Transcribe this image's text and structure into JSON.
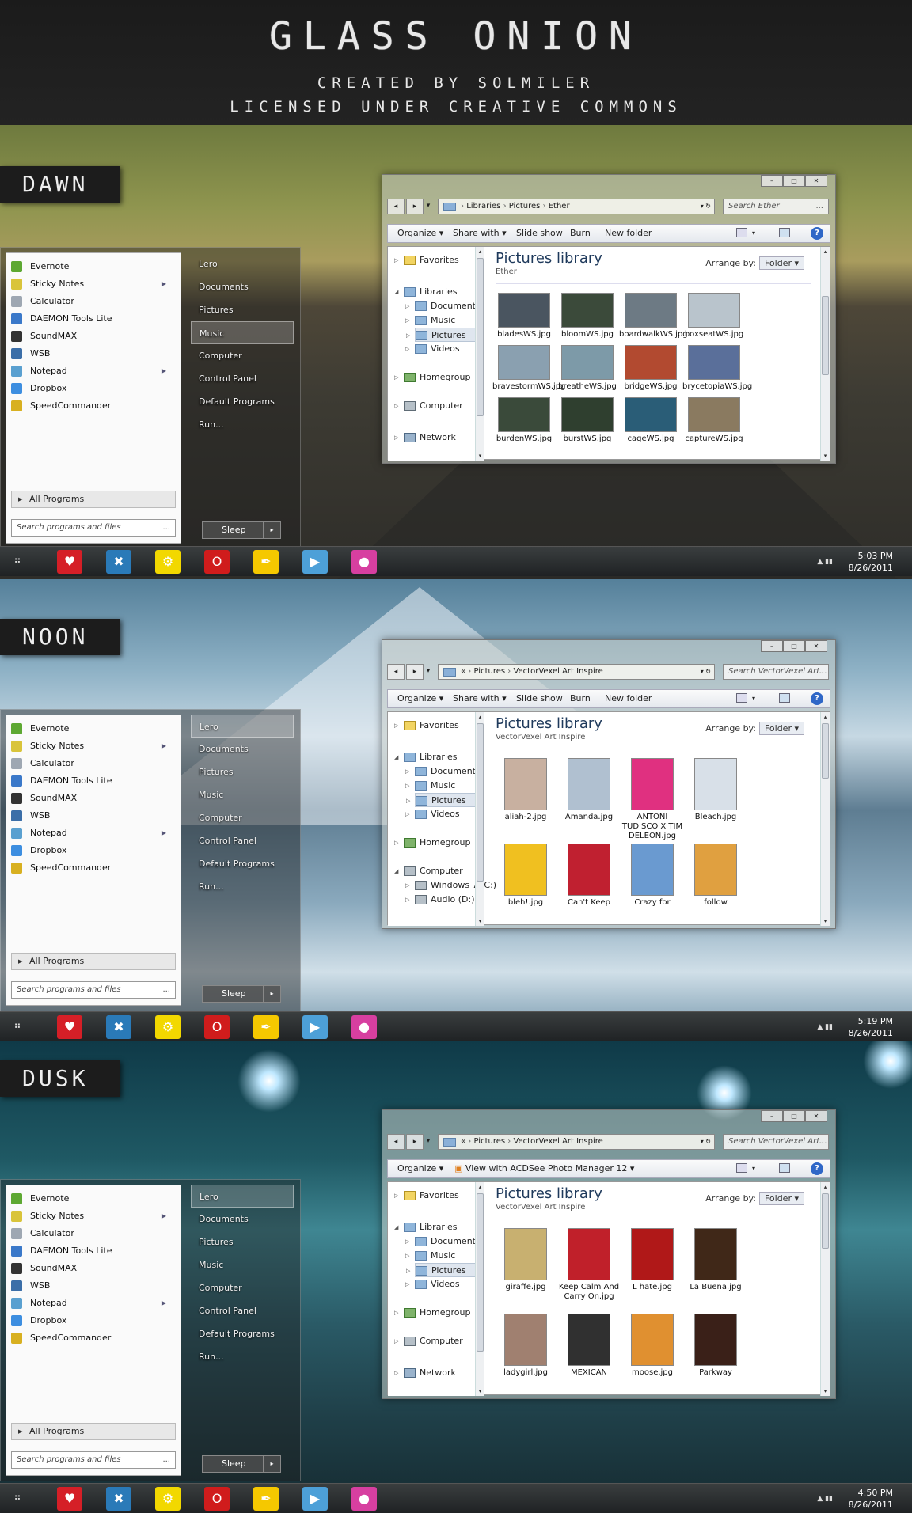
{
  "header": {
    "title": "GLASS ONION",
    "line1": "CREATED BY SOLMILER",
    "line2": "LICENSED UNDER CREATIVE COMMONS"
  },
  "start_menu": {
    "programs": [
      "Evernote",
      "Sticky Notes",
      "Calculator",
      "DAEMON Tools Lite",
      "SoundMAX",
      "WSB",
      "Notepad",
      "Dropbox",
      "SpeedCommander"
    ],
    "all_programs": "All Programs",
    "search_placeholder": "Search programs and files",
    "search_dots": "...",
    "right_links": [
      "Lero",
      "Documents",
      "Pictures",
      "Music",
      "Computer",
      "Control Panel",
      "Default Programs",
      "Run..."
    ],
    "sleep": "Sleep"
  },
  "explorer": {
    "organize": "Organize",
    "share_with": "Share with",
    "slide_show": "Slide show",
    "burn": "Burn",
    "new_folder": "New folder",
    "acdsee": "View with ACDSee Photo Manager 12",
    "library_title": "Pictures library",
    "arrange_by": "Arrange by:",
    "folder": "Folder",
    "nav": {
      "favorites": "Favorites",
      "libraries": "Libraries",
      "documents": "Documents",
      "music": "Music",
      "pictures": "Pictures",
      "videos": "Videos",
      "homegroup": "Homegroup",
      "computer": "Computer",
      "network": "Network",
      "win7": "Windows 7 (C:)",
      "audio": "Audio (D:)"
    }
  },
  "sections": [
    {
      "label": "DAWN",
      "address": [
        "Libraries",
        "Pictures",
        "Ether"
      ],
      "search": "Search Ether",
      "library_sub": "Ether",
      "selected_link": "Music",
      "thumbs": [
        "bladesWS.jpg",
        "bloomWS.jpg",
        "boardwalkWS.jpg",
        "boxseatWS.jpg",
        "bravestormWS.jpg",
        "breatheWS.jpg",
        "bridgeWS.jpg",
        "brycetopiaWS.jpg",
        "burdenWS.jpg",
        "burstWS.jpg",
        "cageWS.jpg",
        "captureWS.jpg"
      ],
      "time": "5:03 PM",
      "date": "8/26/2011"
    },
    {
      "label": "NOON",
      "address": [
        "«",
        "Pictures",
        "VectorVexel Art Inspire"
      ],
      "search": "Search VectorVexel Art...",
      "library_sub": "VectorVexel Art Inspire",
      "selected_link": "Lero",
      "thumbs": [
        "aliah-2.jpg",
        "Amanda.jpg",
        "ANTONI TUDISCO X TIM DELEON.jpg",
        "Bleach.jpg",
        "bleh!.jpg",
        "Can't Keep",
        "Crazy for",
        "follow"
      ],
      "time": "5:19 PM",
      "date": "8/26/2011"
    },
    {
      "label": "DUSK",
      "address": [
        "«",
        "Pictures",
        "VectorVexel Art Inspire"
      ],
      "search": "Search VectorVexel Art...",
      "library_sub": "VectorVexel Art Inspire",
      "selected_link": "Lero",
      "thumbs": [
        "giraffe.jpg",
        "Keep Calm And Carry On.jpg",
        "L hate.jpg",
        "La Buena.jpg",
        "ladygirl.jpg",
        "MEXICAN",
        "moose.jpg",
        "Parkway"
      ],
      "time": "4:50 PM",
      "date": "8/26/2011"
    }
  ],
  "taskbar_icons": [
    "heart-icon",
    "tools-icon",
    "gear-icon",
    "opera-icon",
    "eyedropper-icon",
    "media-player-icon",
    "game-icon"
  ],
  "colors": {
    "taskbar": "#2c3032",
    "accent": "#1e395b",
    "help": "#2f67c7"
  }
}
